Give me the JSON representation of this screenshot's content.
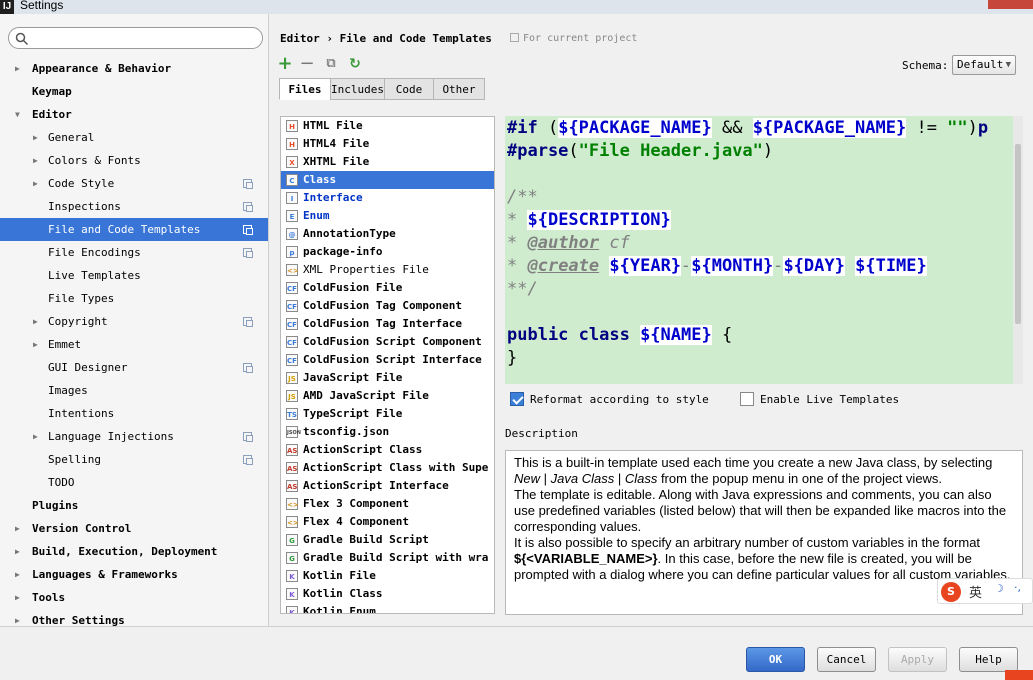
{
  "window": {
    "title": "Settings",
    "logo": "IJ"
  },
  "search": {
    "placeholder": ""
  },
  "tree": [
    {
      "label": "Appearance & Behavior",
      "level": 0,
      "expandable": true,
      "expanded": false
    },
    {
      "label": "Keymap",
      "level": 0,
      "expandable": false
    },
    {
      "label": "Editor",
      "level": 0,
      "expandable": true,
      "expanded": true
    },
    {
      "label": "General",
      "level": 1,
      "expandable": true,
      "expanded": false
    },
    {
      "label": "Colors & Fonts",
      "level": 1,
      "expandable": true,
      "expanded": false
    },
    {
      "label": "Code Style",
      "level": 1,
      "expandable": true,
      "expanded": false,
      "project_icon": true
    },
    {
      "label": "Inspections",
      "level": 1,
      "project_icon": true
    },
    {
      "label": "File and Code Templates",
      "level": 1,
      "selected": true,
      "project_icon": true
    },
    {
      "label": "File Encodings",
      "level": 1,
      "project_icon": true
    },
    {
      "label": "Live Templates",
      "level": 1
    },
    {
      "label": "File Types",
      "level": 1
    },
    {
      "label": "Copyright",
      "level": 1,
      "expandable": true,
      "expanded": false,
      "project_icon": true
    },
    {
      "label": "Emmet",
      "level": 1,
      "expandable": true,
      "expanded": false
    },
    {
      "label": "GUI Designer",
      "level": 1,
      "project_icon": true
    },
    {
      "label": "Images",
      "level": 1
    },
    {
      "label": "Intentions",
      "level": 1
    },
    {
      "label": "Language Injections",
      "level": 1,
      "expandable": true,
      "expanded": false,
      "project_icon": true
    },
    {
      "label": "Spelling",
      "level": 1,
      "project_icon": true
    },
    {
      "label": "TODO",
      "level": 1
    },
    {
      "label": "Plugins",
      "level": 0
    },
    {
      "label": "Version Control",
      "level": 0,
      "expandable": true,
      "expanded": false
    },
    {
      "label": "Build, Execution, Deployment",
      "level": 0,
      "expandable": true,
      "expanded": false
    },
    {
      "label": "Languages & Frameworks",
      "level": 0,
      "expandable": true,
      "expanded": false
    },
    {
      "label": "Tools",
      "level": 0,
      "expandable": true,
      "expanded": false
    },
    {
      "label": "Other Settings",
      "level": 0,
      "expandable": true,
      "expanded": false
    }
  ],
  "header": {
    "breadcrumb": "Editor › File and Code Templates",
    "scope": "For current project"
  },
  "toolbar": {
    "add_glyph": "+",
    "remove_glyph": "−",
    "copy_glyph": "⧉",
    "reset_glyph": "↻"
  },
  "schema": {
    "label": "Schema:",
    "value": "Default"
  },
  "tabs": [
    "Files",
    "Includes",
    "Code",
    "Other"
  ],
  "active_tab": "Files",
  "files": [
    {
      "name": "HTML File",
      "icon": "H",
      "icon_color": "#e44d26"
    },
    {
      "name": "HTML4 File",
      "icon": "H",
      "icon_color": "#e44d26"
    },
    {
      "name": "XHTML File",
      "icon": "X",
      "icon_color": "#e44d26"
    },
    {
      "name": "Class",
      "icon": "C",
      "selected": true,
      "blue": true,
      "icon_color": "#3a7ad8"
    },
    {
      "name": "Interface",
      "icon": "I",
      "blue": true,
      "icon_color": "#3a7ad8"
    },
    {
      "name": "Enum",
      "icon": "E",
      "blue": true,
      "icon_color": "#3a7ad8"
    },
    {
      "name": "AnnotationType",
      "icon": "@",
      "icon_color": "#3a7ad8"
    },
    {
      "name": "package-info",
      "icon": "p",
      "icon_color": "#3a7ad8"
    },
    {
      "name": "XML Properties File",
      "icon": "<>",
      "thin": true,
      "icon_color": "#d28d1c"
    },
    {
      "name": "ColdFusion File",
      "icon": "CF",
      "icon_color": "#3a7ad8"
    },
    {
      "name": "ColdFusion Tag Component",
      "icon": "CF",
      "icon_color": "#3a7ad8"
    },
    {
      "name": "ColdFusion Tag Interface",
      "icon": "CF",
      "icon_color": "#3a7ad8"
    },
    {
      "name": "ColdFusion Script Component",
      "icon": "CF",
      "icon_color": "#3a7ad8"
    },
    {
      "name": "ColdFusion Script Interface",
      "icon": "CF",
      "icon_color": "#3a7ad8"
    },
    {
      "name": "JavaScript File",
      "icon": "JS",
      "icon_color": "#d0a000"
    },
    {
      "name": "AMD JavaScript File",
      "icon": "JS",
      "icon_color": "#d0a000"
    },
    {
      "name": "TypeScript File",
      "icon": "TS",
      "icon_color": "#3a7ad8"
    },
    {
      "name": "tsconfig.json",
      "icon": "JSON",
      "icon_color": "#444"
    },
    {
      "name": "ActionScript Class",
      "icon": "AS",
      "icon_color": "#c23a2a"
    },
    {
      "name": "ActionScript Class with Supe",
      "icon": "AS",
      "icon_color": "#c23a2a"
    },
    {
      "name": "ActionScript Interface",
      "icon": "AS",
      "icon_color": "#c23a2a"
    },
    {
      "name": "Flex 3 Component",
      "icon": "<>",
      "icon_color": "#d28d1c"
    },
    {
      "name": "Flex 4 Component",
      "icon": "<>",
      "icon_color": "#d28d1c"
    },
    {
      "name": "Gradle Build Script",
      "icon": "G",
      "icon_color": "#2e9a3a"
    },
    {
      "name": "Gradle Build Script with wra",
      "icon": "G",
      "icon_color": "#2e9a3a"
    },
    {
      "name": "Kotlin File",
      "icon": "K",
      "icon_color": "#7b5ad6"
    },
    {
      "name": "Kotlin Class",
      "icon": "K",
      "icon_color": "#7b5ad6"
    },
    {
      "name": "Kotlin Enum",
      "icon": "K",
      "icon_color": "#7b5ad6"
    }
  ],
  "code": {
    "lines": [
      [
        {
          "t": "#if",
          "c": "kw"
        },
        {
          "t": " (",
          "c": ""
        },
        {
          "t": "${PACKAGE_NAME}",
          "c": "var hl"
        },
        {
          "t": " && ",
          "c": ""
        },
        {
          "t": "${PACKAGE_NAME}",
          "c": "var hl"
        },
        {
          "t": " != ",
          "c": ""
        },
        {
          "t": "\"\"",
          "c": "str"
        },
        {
          "t": ")",
          "c": ""
        },
        {
          "t": "p",
          "c": "kw"
        }
      ],
      [
        {
          "t": "#parse",
          "c": "kw"
        },
        {
          "t": "(",
          "c": ""
        },
        {
          "t": "\"File Header.java\"",
          "c": "str"
        },
        {
          "t": ")",
          "c": ""
        }
      ],
      [],
      [
        {
          "t": "/**",
          "c": "cmt"
        }
      ],
      [
        {
          "t": "* ",
          "c": "cmt"
        },
        {
          "t": "${DESCRIPTION}",
          "c": "var hl"
        }
      ],
      [
        {
          "t": "* ",
          "c": "cmt"
        },
        {
          "t": "@author",
          "c": "tag"
        },
        {
          "t": " cf",
          "c": "cmt"
        }
      ],
      [
        {
          "t": "* ",
          "c": "cmt"
        },
        {
          "t": "@create",
          "c": "tag"
        },
        {
          "t": " ",
          "c": "cmt"
        },
        {
          "t": "${YEAR}",
          "c": "var hl"
        },
        {
          "t": "-",
          "c": "cmt"
        },
        {
          "t": "${MONTH}",
          "c": "var hl"
        },
        {
          "t": "-",
          "c": "cmt"
        },
        {
          "t": "${DAY}",
          "c": "var hl"
        },
        {
          "t": " ",
          "c": "cmt"
        },
        {
          "t": "${TIME}",
          "c": "var hl"
        }
      ],
      [
        {
          "t": "**/",
          "c": "cmt"
        }
      ],
      [],
      [
        {
          "t": "public class ",
          "c": "kw"
        },
        {
          "t": "${NAME}",
          "c": "var hl"
        },
        {
          "t": " {",
          "c": ""
        }
      ],
      [
        {
          "t": "}",
          "c": ""
        }
      ]
    ]
  },
  "options": {
    "reformat": {
      "label": "Reformat according to style",
      "checked": true
    },
    "live": {
      "label": "Enable Live Templates",
      "checked": false
    }
  },
  "description": {
    "label": "Description",
    "paragraphs": [
      [
        {
          "t": "This is a built-in template used each time you create a new Java class, by selecting "
        },
        {
          "t": "New",
          "s": "i"
        },
        {
          "t": " | "
        },
        {
          "t": "Java Class",
          "s": "i"
        },
        {
          "t": " | "
        },
        {
          "t": "Class",
          "s": "i"
        },
        {
          "t": " from the popup menu in one of the project views."
        }
      ],
      [
        {
          "t": "The template is editable. Along with Java expressions and comments, you can also use predefined variables (listed below) that will then be expanded like macros into the corresponding values."
        }
      ],
      [
        {
          "t": "It is also possible to specify an arbitrary number of custom variables in the format "
        },
        {
          "t": "${<VARIABLE_NAME>}",
          "s": "b"
        },
        {
          "t": ". In this case, before the new file is created, you will be prompted with a dialog where you can define particular values for all custom variables."
        }
      ]
    ]
  },
  "ime": {
    "logo": "S",
    "lang": "英",
    "moon": "☽",
    "dots": "·,"
  },
  "buttons": {
    "ok": "OK",
    "cancel": "Cancel",
    "apply": "Apply",
    "help": "Help"
  }
}
